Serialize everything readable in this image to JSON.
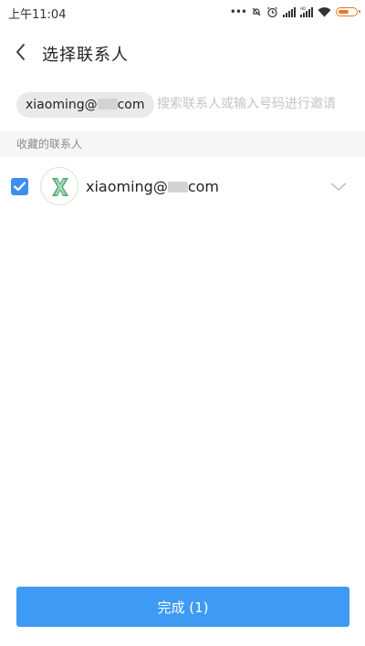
{
  "status_bar": {
    "time": "上午11:04",
    "icons": [
      "more-dots-icon",
      "dnd-icon",
      "alarm-icon",
      "signal-icon",
      "hd-signal-icon",
      "wifi-icon",
      "battery-icon"
    ],
    "battery_color": "#e8742a"
  },
  "header": {
    "title": "选择联系人"
  },
  "search": {
    "selected_chip_prefix": "xiaoming@",
    "selected_chip_suffix": "com",
    "placeholder": "搜索联系人或输入号码进行邀请"
  },
  "section": {
    "label": "收藏的联系人"
  },
  "contacts": [
    {
      "name_prefix": "xiaoming@",
      "name_suffix": "com",
      "checked": true,
      "avatar_letter": "X",
      "avatar_color": "#2e9b52"
    }
  ],
  "footer": {
    "done_label": "完成 (1)",
    "accent": "#3d9bf3"
  }
}
